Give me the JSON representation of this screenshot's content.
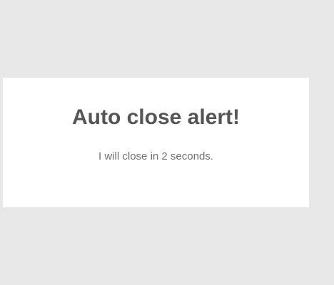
{
  "alert": {
    "title": "Auto close alert!",
    "message": "I will close in 2 seconds."
  },
  "colors": {
    "overlay_background": "#e8e8e8",
    "dialog_background": "#ffffff",
    "title_color": "#555555",
    "message_color": "#707070"
  }
}
